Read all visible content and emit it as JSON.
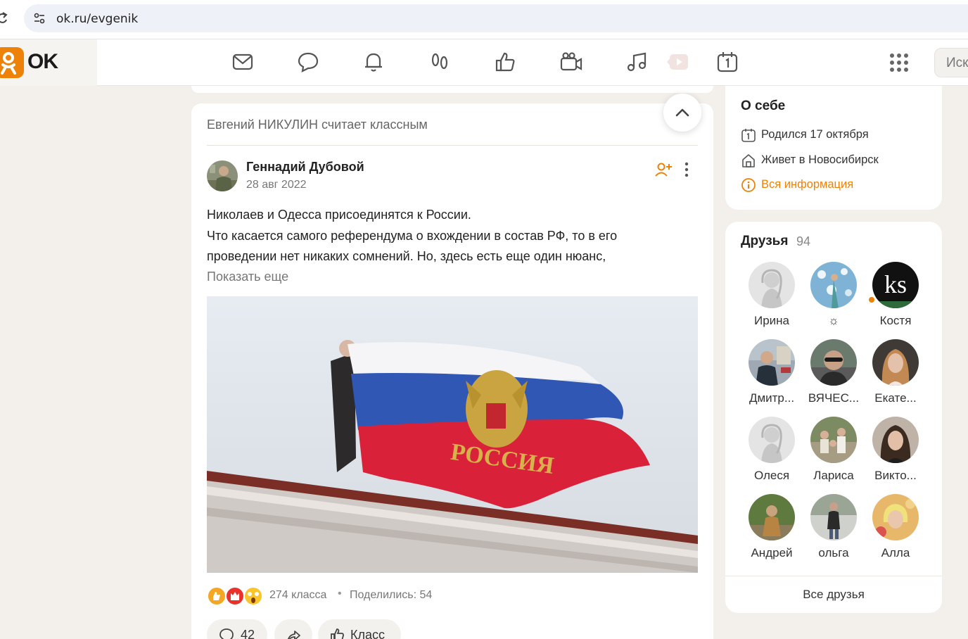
{
  "browser": {
    "url": "ok.ru/evgenik"
  },
  "header": {
    "logo_text": "OK",
    "search_placeholder": "Иск",
    "nav_icons": [
      "mail-icon",
      "chat-icon",
      "bell-icon",
      "guests-icon",
      "like-icon",
      "video-camera-icon",
      "music-icon",
      "play-icon",
      "calendar-icon"
    ]
  },
  "feed": {
    "context_line": "Евгений НИКУЛИН считает классным",
    "post": {
      "author": "Геннадий Дубовой",
      "date": "28 авг 2022",
      "text_lines": [
        "Николаев и Одесса присоединятся к России.",
        "Что касается самого референдума о вхождении в состав РФ, то в его",
        "проведении нет никаких сомнений. Но, здесь есть еще один нюанс,"
      ],
      "show_more": "Показать еще",
      "image_caption_text": "РОССИЯ",
      "likes": "274 класса",
      "separator": "•",
      "shares": "Поделились: 54",
      "comments_count": "42",
      "class_label": "Класс"
    }
  },
  "about": {
    "title": "О себе",
    "birthday": "Родился 17 октября",
    "lives": "Живет в Новосибирск",
    "all_info": "Вся информация"
  },
  "friends": {
    "title": "Друзья",
    "count": "94",
    "items": [
      {
        "name": "Ирина"
      },
      {
        "name": "☼"
      },
      {
        "name": "Костя"
      },
      {
        "name": "Дмитр..."
      },
      {
        "name": "ВЯЧЕС..."
      },
      {
        "name": "Екате..."
      },
      {
        "name": "Олеся"
      },
      {
        "name": "Лариса"
      },
      {
        "name": "Викто..."
      },
      {
        "name": "Андрей"
      },
      {
        "name": "ольга"
      },
      {
        "name": "Алла"
      }
    ],
    "all_friends": "Все друзья",
    "avatar_badge": "ks"
  },
  "colors": {
    "accent": "#ee8208",
    "page_bg": "#f3efeb"
  }
}
